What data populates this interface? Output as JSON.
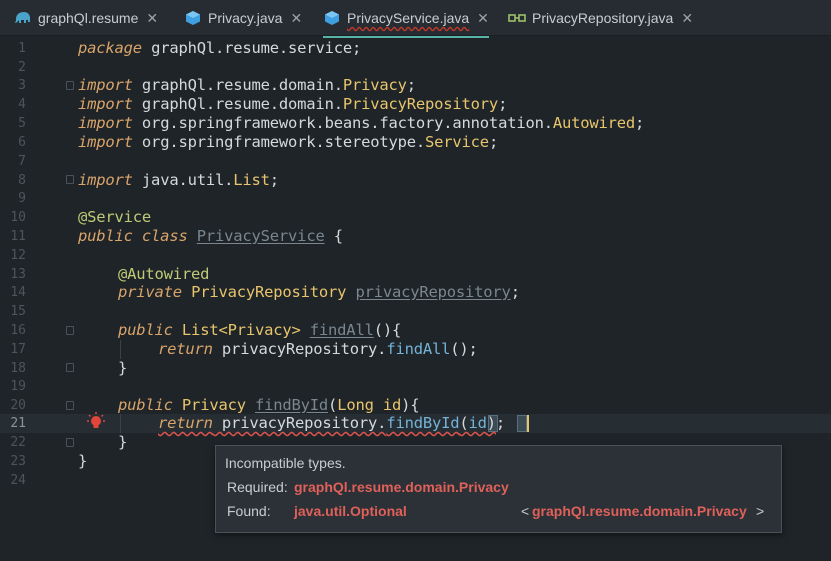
{
  "tabs": [
    {
      "label": "graphQl.resume",
      "icon": "elephant-icon",
      "active": false
    },
    {
      "label": "Privacy.java",
      "icon": "class-cube-icon",
      "active": false
    },
    {
      "label": "PrivacyService.java",
      "icon": "class-cube-icon",
      "active": true
    },
    {
      "label": "PrivacyRepository.java",
      "icon": "interface-icon",
      "active": false
    }
  ],
  "close_glyph": "✕",
  "line_numbers": [
    "1",
    "2",
    "3",
    "4",
    "5",
    "6",
    "7",
    "8",
    "9",
    "10",
    "11",
    "12",
    "13",
    "14",
    "15",
    "16",
    "17",
    "18",
    "19",
    "20",
    "21",
    "22",
    "23",
    "24"
  ],
  "code": {
    "l1_kw": "package",
    "l1_rest": " graphQl.resume.service;",
    "l3_kw": "import",
    "l3_pkg": " graphQl.resume.domain.",
    "l3_cls": "Privacy",
    "l3_end": ";",
    "l4_kw": "import",
    "l4_pkg": " graphQl.resume.domain.",
    "l4_cls": "PrivacyRepository",
    "l4_end": ";",
    "l5_kw": "import",
    "l5_pkg": " org.springframework.beans.factory.annotation.",
    "l5_cls": "Autowired",
    "l5_end": ";",
    "l6_kw": "import",
    "l6_pkg": " org.springframework.stereotype.",
    "l6_cls": "Service",
    "l6_end": ";",
    "l8_kw": "import",
    "l8_pkg": " java.util.",
    "l8_cls": "List",
    "l8_end": ";",
    "l10_ann": "@Service",
    "l11_kw": "public class",
    "l11_name": "PrivacyService",
    "l11_end": " {",
    "l13_ann": "@Autowired",
    "l14_kw": "private",
    "l14_type": " PrivacyRepository ",
    "l14_field": "privacyRepository",
    "l14_end": ";",
    "l16_kw": "public",
    "l16_type": " List<Privacy> ",
    "l16_name": "findAll",
    "l16_end": "(){",
    "l17_kw": "return",
    "l17_obj": " privacyRepository.",
    "l17_mth": "findAll",
    "l17_end": "();",
    "l18": "}",
    "l20_kw": "public",
    "l20_type": " Privacy ",
    "l20_name": "findById",
    "l20_paren": "(",
    "l20_param": "Long id",
    "l20_end": "){",
    "l21_kw": "return",
    "l21_obj": " privacyRepository.",
    "l21_mth": "findById",
    "l21_open": "(",
    "l21_arg": "id",
    "l21_close": ")",
    "l21_end": ";",
    "l22": "}",
    "l23": "}"
  },
  "tooltip": {
    "title": "Incompatible types.",
    "required_label": "Required:",
    "required_value": "graphQl.resume.domain.Privacy",
    "found_label": "Found:",
    "found_value": "java.util.Optional",
    "found_generic_open": "<",
    "found_generic_value": "graphQl.resume.domain.Privacy",
    "found_generic_close": ">"
  },
  "colors": {
    "background": "#1e2428",
    "keyword": "#d9a46a",
    "type": "#e8c56d",
    "method": "#74b2d8",
    "annotation": "#c0ca76",
    "error": "#e0605a",
    "tab_active_underline": "#57b3a6"
  }
}
